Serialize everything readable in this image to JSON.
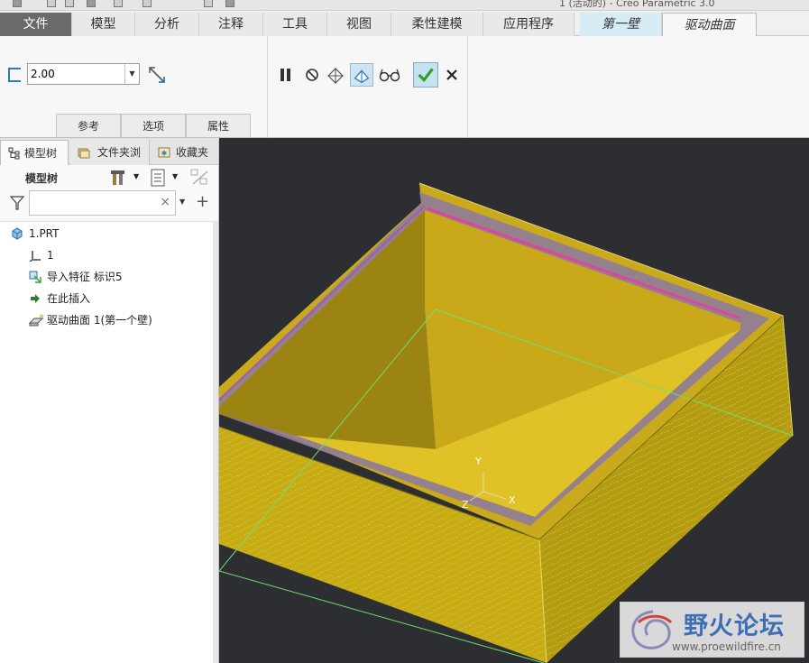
{
  "window": {
    "title": "1 (活动的) - Creo Parametric 3.0"
  },
  "ribbon": {
    "tabs": [
      {
        "label": "文件"
      },
      {
        "label": "模型"
      },
      {
        "label": "分析"
      },
      {
        "label": "注释"
      },
      {
        "label": "工具"
      },
      {
        "label": "视图"
      },
      {
        "label": "柔性建模"
      },
      {
        "label": "应用程序"
      },
      {
        "label": "第一壁"
      },
      {
        "label": "驱动曲面"
      }
    ],
    "active_tab": "驱动曲面",
    "thickness_value": "2.00",
    "subtabs": [
      "参考",
      "选项",
      "属性"
    ]
  },
  "navigator": {
    "tabs": [
      {
        "label": "模型树"
      },
      {
        "label": "文件夹浏"
      },
      {
        "label": "收藏夹"
      }
    ],
    "header": "模型树",
    "search_value": "",
    "tree": [
      {
        "label": "1.PRT",
        "icon": "part-icon"
      },
      {
        "label": "1",
        "icon": "csys-icon"
      },
      {
        "label": "导入特征 标识5",
        "icon": "import-feature-icon"
      },
      {
        "label": "在此插入",
        "icon": "insert-here-arrow-icon"
      },
      {
        "label": "驱动曲面 1(第一个壁)",
        "icon": "drive-surface-icon"
      }
    ]
  },
  "viewport": {
    "triad": {
      "x": "X",
      "y": "Y",
      "z": "Z"
    },
    "model_color": "#d8b820",
    "background": "#2d2e32"
  },
  "watermark": {
    "title": "野火论坛",
    "url": "www.proewildfire.cn"
  },
  "colors": {
    "accent_blue": "#2a7cc0",
    "ok_green": "#2e9e2e",
    "contextual_tab": "#d8ecf5"
  }
}
